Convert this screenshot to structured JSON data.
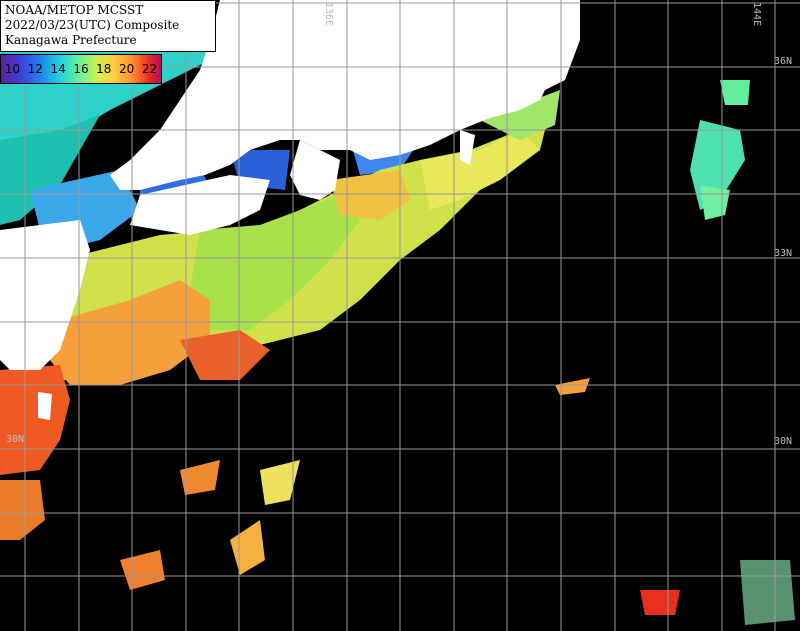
{
  "title": {
    "line1": "NOAA/METOP MCSST",
    "line2": "2022/03/23(UTC) Composite",
    "line3": "Kanagawa Prefecture"
  },
  "legend": {
    "values": [
      "10",
      "12",
      "14",
      "16",
      "18",
      "20",
      "22"
    ],
    "colors": [
      "#5a1f9e",
      "#3f3fd8",
      "#1f7fef",
      "#1fcfdf",
      "#5fef9f",
      "#cfef4f",
      "#ffcf3f",
      "#ff8f2f",
      "#e83020",
      "#b0105a"
    ]
  },
  "grid_labels": {
    "lon_136": "136E",
    "lon_144": "144E",
    "lat_36": "36N",
    "lat_33": "33N",
    "lat_30_left": "30N",
    "lat_30_right": "30N"
  },
  "land_color": "#ffffff",
  "grid_color": "#9a9a9a"
}
